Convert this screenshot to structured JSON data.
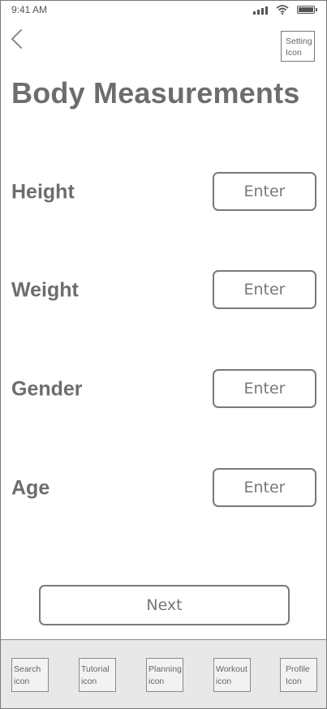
{
  "status_bar": {
    "time": "9:41 AM"
  },
  "header": {
    "back_icon": "chevron-left-icon",
    "setting_label": "Setting\nIcon",
    "title": "Body Measurements"
  },
  "fields": [
    {
      "label": "Height",
      "value": "Enter"
    },
    {
      "label": "Weight",
      "value": "Enter"
    },
    {
      "label": "Gender",
      "value": "Enter"
    },
    {
      "label": "Age",
      "value": "Enter"
    }
  ],
  "next_label": "Next",
  "tab_bar": {
    "items": [
      {
        "label": "Search\nicon"
      },
      {
        "label": "Tutorial\nicon"
      },
      {
        "label": "Planning\nicon"
      },
      {
        "label": "Workout\nicon"
      },
      {
        "label": "Profile\nIcon"
      }
    ]
  },
  "colors": {
    "text": "#6d6d6d",
    "border": "#7a7a7a",
    "tab_bar_bg": "#e8e8e8"
  }
}
